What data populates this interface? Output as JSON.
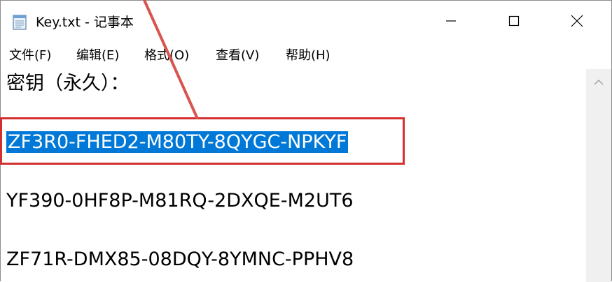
{
  "window": {
    "title": "Key.txt - 记事本"
  },
  "menu": {
    "file": "文件(F)",
    "edit": "编辑(E)",
    "format": "格式(O)",
    "view": "查看(V)",
    "help": "帮助(H)"
  },
  "content": {
    "lines": [
      "密钥（永久）：",
      "ZF3R0-FHED2-M80TY-8QYGC-NPKYF",
      "YF390-0HF8P-M81RQ-2DXQE-M2UT6",
      "ZF71R-DMX85-08DQY-8YMNC-PPHV8"
    ]
  },
  "colors": {
    "selection": "#0078d7",
    "annotation": "#d32f2f"
  },
  "icons": {
    "app": "notepad-icon",
    "minimize": "minimize-icon",
    "maximize": "maximize-icon",
    "close": "close-icon",
    "scroll_up": "chevron-up-icon"
  }
}
